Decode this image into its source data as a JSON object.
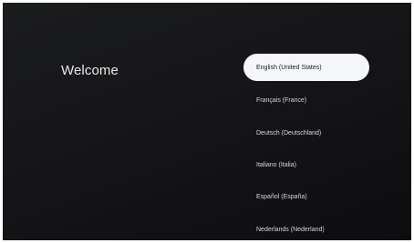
{
  "screen": {
    "title": "Welcome"
  },
  "languages": [
    {
      "label": "English (United States)",
      "selected": true
    },
    {
      "label": "Français (France)",
      "selected": false
    },
    {
      "label": "Deutsch (Deutschland)",
      "selected": false
    },
    {
      "label": "Italiano (Italia)",
      "selected": false
    },
    {
      "label": "Español (España)",
      "selected": false
    },
    {
      "label": "Nederlands (Nederland)",
      "selected": false
    }
  ]
}
